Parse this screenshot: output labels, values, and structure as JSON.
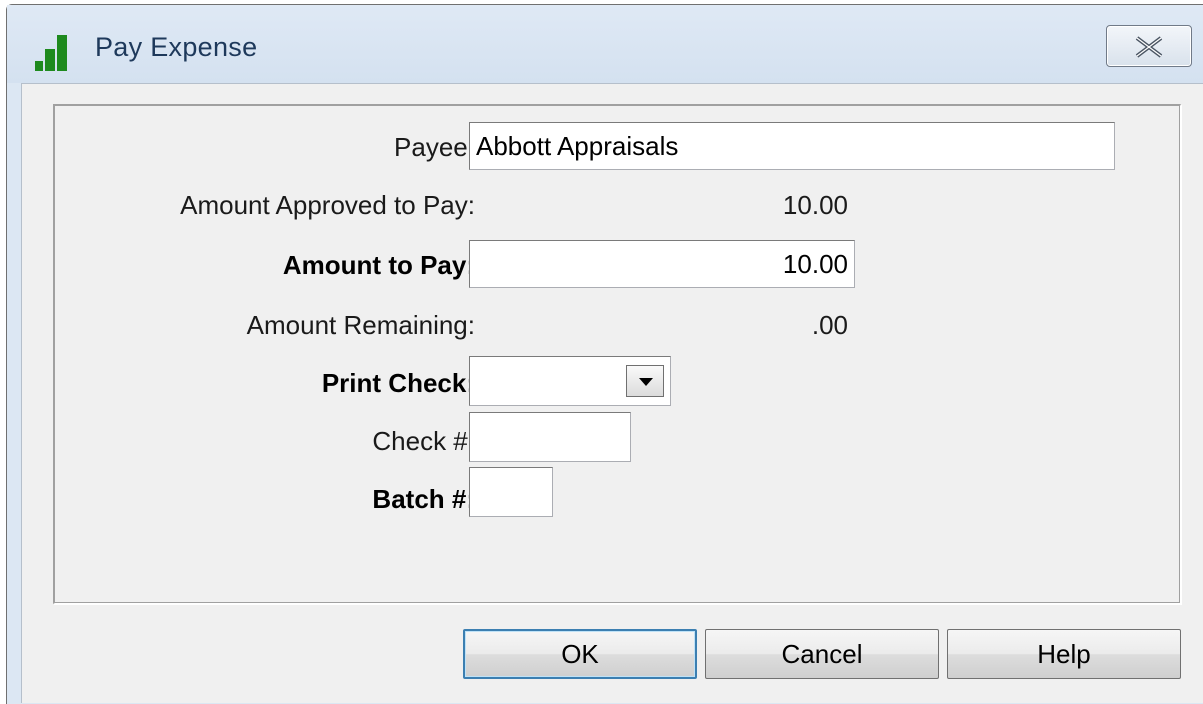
{
  "window": {
    "title": "Pay Expense",
    "app_icon": "bar-chart-icon",
    "close_icon": "close-icon"
  },
  "form": {
    "payee": {
      "label": "Payee:",
      "value": "Abbott Appraisals"
    },
    "amount_approved": {
      "label": "Amount Approved to Pay:",
      "value": "10.00"
    },
    "amount_to_pay": {
      "label": "Amount to Pay:",
      "value": "10.00"
    },
    "amount_remaining": {
      "label": "Amount Remaining:",
      "value": ".00"
    },
    "print_check": {
      "label": "Print Check:",
      "value": ""
    },
    "check_number": {
      "label": "Check #:",
      "value": ""
    },
    "batch_number": {
      "label": "Batch #:",
      "value": ""
    }
  },
  "buttons": {
    "ok": "OK",
    "cancel": "Cancel",
    "help": "Help"
  },
  "colors": {
    "titlebar": "#dce7f3",
    "title_text": "#1e395b",
    "client_bg": "#f0f0f0",
    "icon_green": "#1e8a1e"
  }
}
